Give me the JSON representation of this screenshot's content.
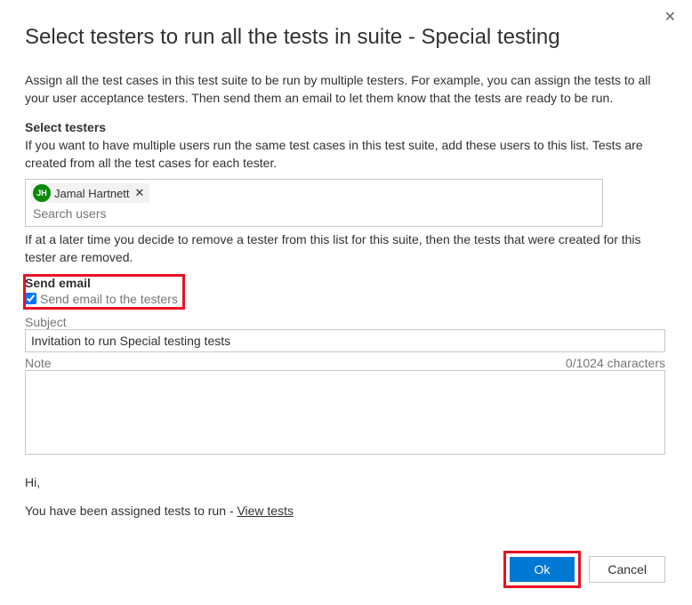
{
  "dialog": {
    "title": "Select testers to run all the tests in suite - Special testing",
    "intro": "Assign all the test cases in this test suite to be run by multiple testers. For example, you can assign the tests to all your user acceptance testers. Then send them an email to let them know that the tests are ready to be run."
  },
  "selectTesters": {
    "heading": "Select testers",
    "desc": "If you want to have multiple users run the same test cases in this test suite, add these users to this list. Tests are created from all the test cases for each tester.",
    "chip": {
      "initials": "JH",
      "name": "Jamal Hartnett",
      "removeGlyph": "✕"
    },
    "searchPlaceholder": "Search users",
    "afterNote": "If at a later time you decide to remove a tester from this list for this suite, then the tests that were created for this tester are removed."
  },
  "sendEmail": {
    "heading": "Send email",
    "checkboxLabel": "Send email to the testers",
    "checked": true,
    "subjectLabel": "Subject",
    "subjectValue": "Invitation to run Special testing tests",
    "noteLabel": "Note",
    "charCounter": "0/1024 characters"
  },
  "preview": {
    "greeting": "Hi,",
    "assignedPrefix": "You have been assigned tests to run - ",
    "viewTestsLink": "View tests"
  },
  "buttons": {
    "ok": "Ok",
    "cancel": "Cancel"
  }
}
